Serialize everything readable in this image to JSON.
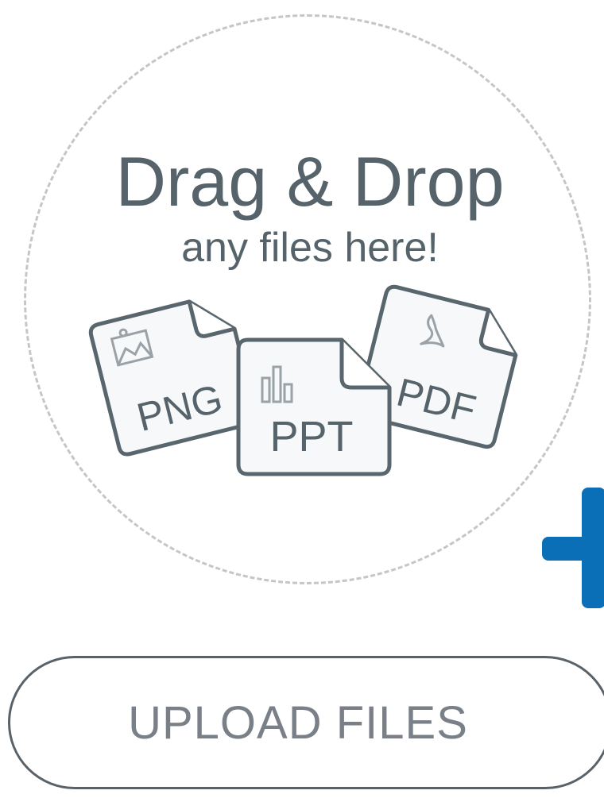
{
  "dropzone": {
    "title": "Drag & Drop",
    "subtitle": "any files here!",
    "file_types": [
      {
        "label": "PNG",
        "icon": "image-icon"
      },
      {
        "label": "PPT",
        "icon": "bar-chart-icon"
      },
      {
        "label": "PDF",
        "icon": "acrobat-icon"
      }
    ]
  },
  "plus": {
    "icon": "plus-icon",
    "color": "#0b6fb8"
  },
  "upload_button": {
    "label": "UPLOAD FILES"
  },
  "colors": {
    "text": "#56636b",
    "icon_stroke": "#5a666e",
    "dash": "#c4c6c9",
    "accent": "#0b6fb8"
  }
}
